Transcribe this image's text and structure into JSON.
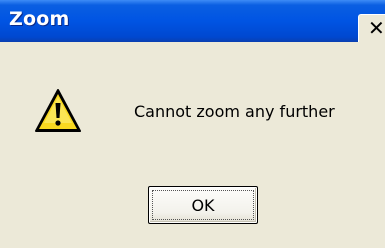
{
  "dialog": {
    "title": "Zoom",
    "close_glyph": "✕",
    "message": "Cannot zoom any further",
    "icon": "warning-icon",
    "ok_label": "OK"
  },
  "colors": {
    "titlebar": "#0054e3",
    "dialog_bg": "#ece9d8",
    "warning_yellow": "#f8d820"
  }
}
